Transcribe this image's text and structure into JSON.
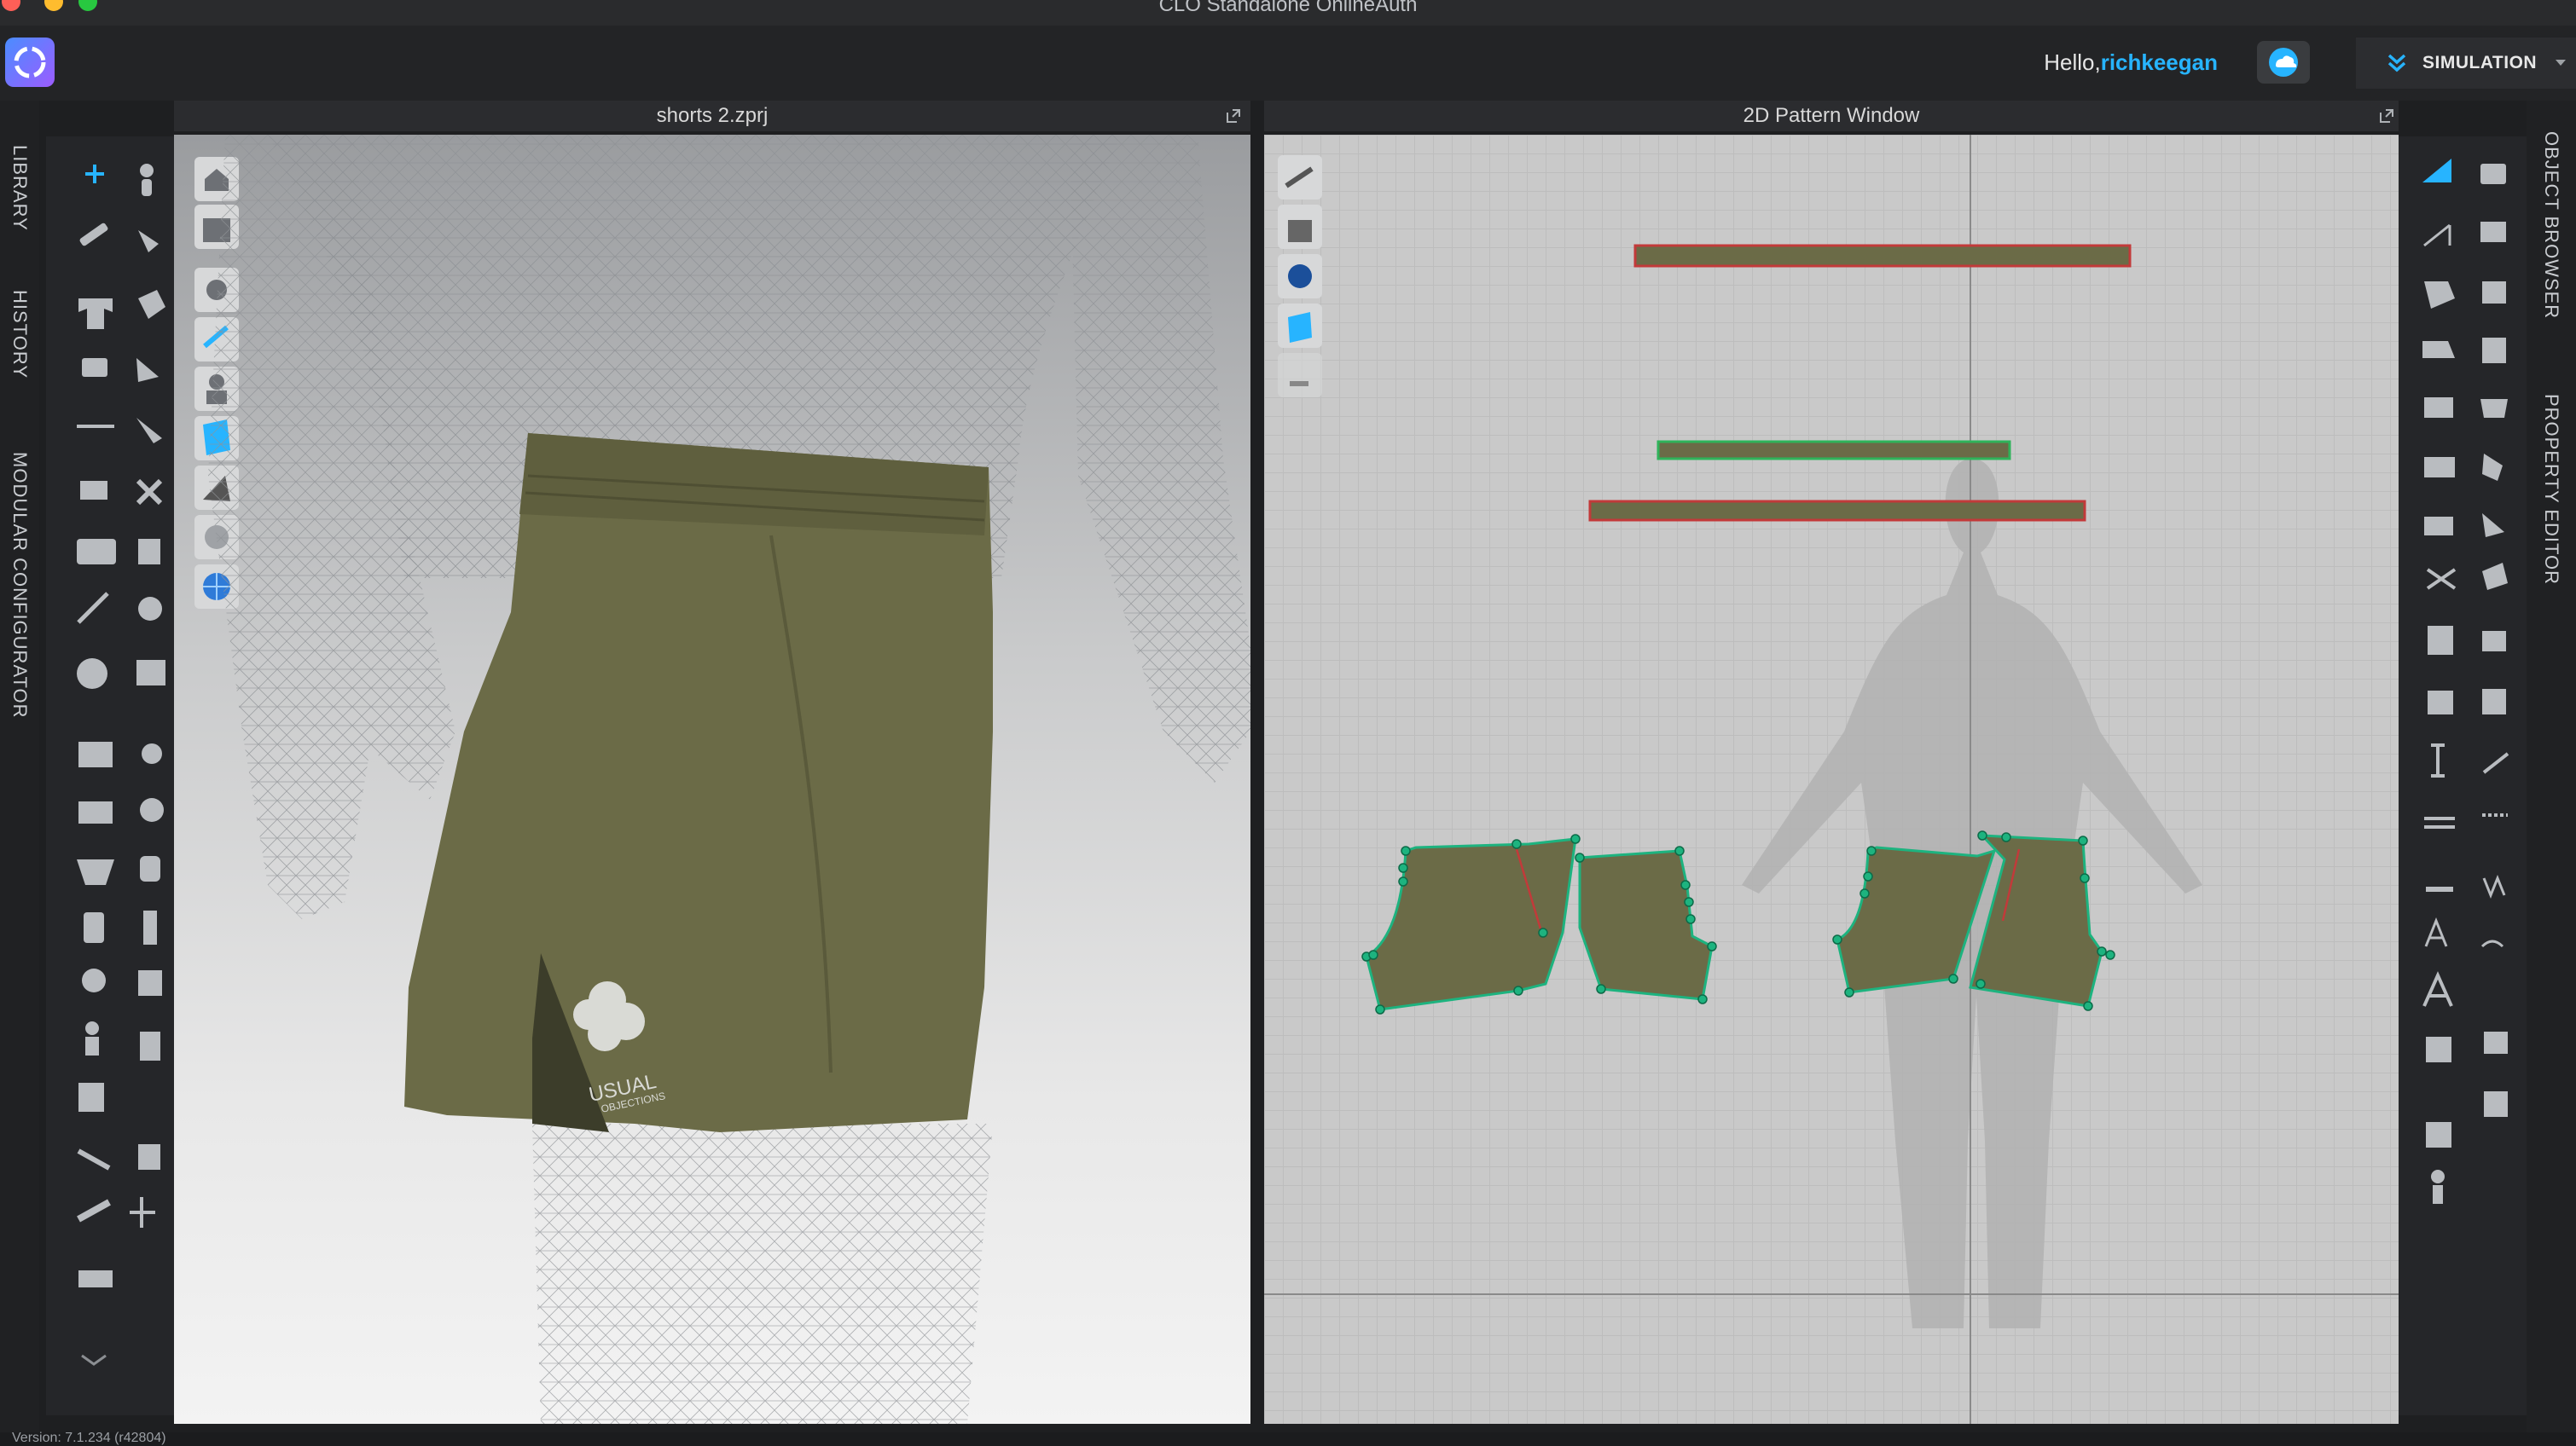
{
  "window": {
    "title": "CLO Standalone OnlineAuth"
  },
  "header": {
    "greeting_prefix": "Hello,",
    "username": "richkeegan",
    "mode_label": "SIMULATION",
    "accent": "#27b4ff"
  },
  "left_tabs": [
    "LIBRARY",
    "HISTORY",
    "MODULAR CONFIGURATOR"
  ],
  "right_tabs": [
    "OBJECT BROWSER",
    "PROPERTY EDITOR"
  ],
  "view3d": {
    "title": "shorts 2.zprj",
    "logo_text_1": "USUAL",
    "logo_text_2": "OBJECTIONS"
  },
  "view2d": {
    "title": "2D Pattern Window"
  },
  "status": {
    "version": "Version: 7.1.234 (r42804)"
  },
  "colors": {
    "fabric": "#6b6b47",
    "fabric_dark": "#5a5a3b",
    "point": "#1db37f",
    "seam": "#c23a3a"
  }
}
